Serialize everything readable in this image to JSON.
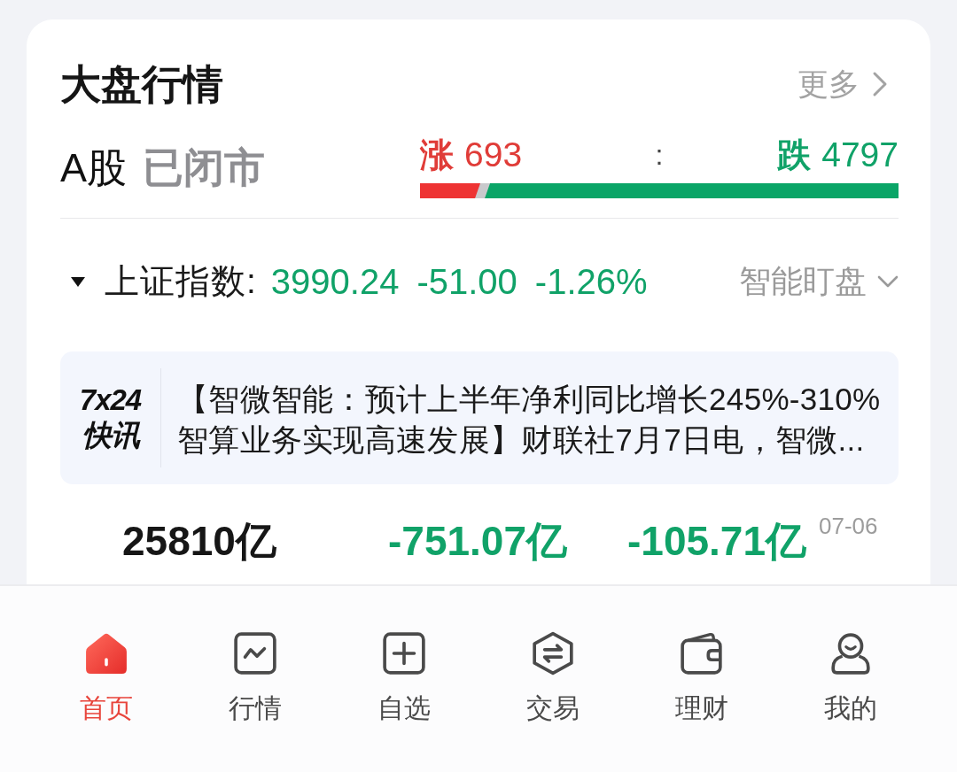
{
  "header": {
    "title": "大盘行情",
    "more": "更多"
  },
  "market": {
    "name": "A股",
    "status": "已闭市",
    "rise_label": "涨",
    "rise_count": "693",
    "separator": ":",
    "fall_label": "跌",
    "fall_count": "4797",
    "level": 0.126
  },
  "index": {
    "name": "上证指数:",
    "price": "3990.24",
    "change": "-51.00",
    "percent": "-1.26%",
    "watch": "智能盯盘"
  },
  "news": {
    "badge_top": "7x24",
    "badge_bottom": "快讯",
    "text": "【智微智能：预计上半年净利同比增长245%-310% 智算业务实现高速发展】财联社7月7日电，智微..."
  },
  "stats": {
    "items": [
      {
        "value": "25810亿",
        "color": "#161616"
      },
      {
        "value": "-751.07亿",
        "color": "#10a268"
      },
      {
        "value": "-105.71亿",
        "color": "#10a268"
      }
    ],
    "date": "07-06"
  },
  "tabs": [
    {
      "label": "首页",
      "selected": true
    },
    {
      "label": "行情",
      "selected": false
    },
    {
      "label": "自选",
      "selected": false
    },
    {
      "label": "交易",
      "selected": false
    },
    {
      "label": "理财",
      "selected": false
    },
    {
      "label": "我的",
      "selected": false
    }
  ]
}
